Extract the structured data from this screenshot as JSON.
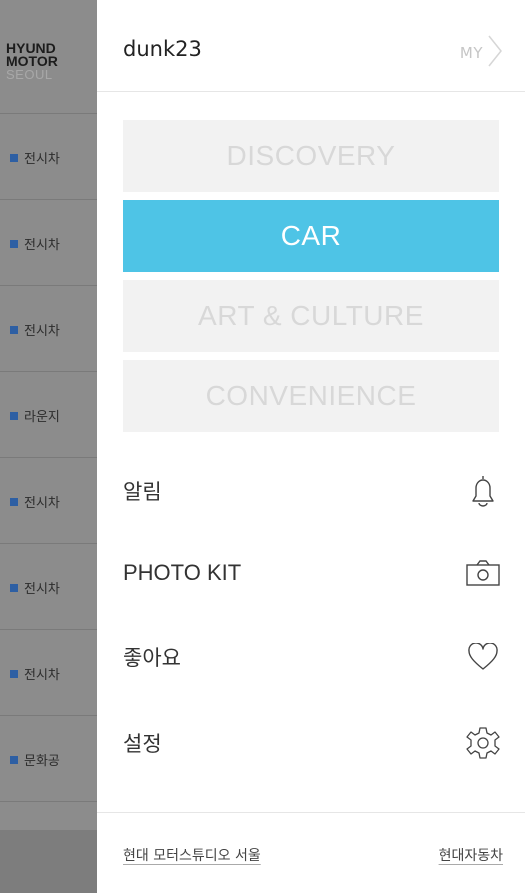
{
  "background": {
    "logo": {
      "line1": "HYUND",
      "line2": "MOTOR",
      "line3": "SEOUL"
    },
    "rows": [
      "전시차",
      "전시차",
      "전시차",
      "라운지",
      "전시차",
      "전시차",
      "전시차",
      "문화공"
    ]
  },
  "header": {
    "username": "dunk23",
    "my_label": "MY"
  },
  "categories": [
    {
      "label": "DISCOVERY",
      "active": false
    },
    {
      "label": "CAR",
      "active": true
    },
    {
      "label": "ART & CULTURE",
      "active": false
    },
    {
      "label": "CONVENIENCE",
      "active": false
    }
  ],
  "menu": {
    "notifications": "알림",
    "photo_kit": "PHOTO KIT",
    "likes": "좋아요",
    "settings": "설정"
  },
  "footer": {
    "left_link": "현대 모터스튜디오 서울",
    "right_link": "현대자동차"
  },
  "colors": {
    "accent": "#4ec4e6",
    "inactive_tile": "#f2f2f2"
  }
}
